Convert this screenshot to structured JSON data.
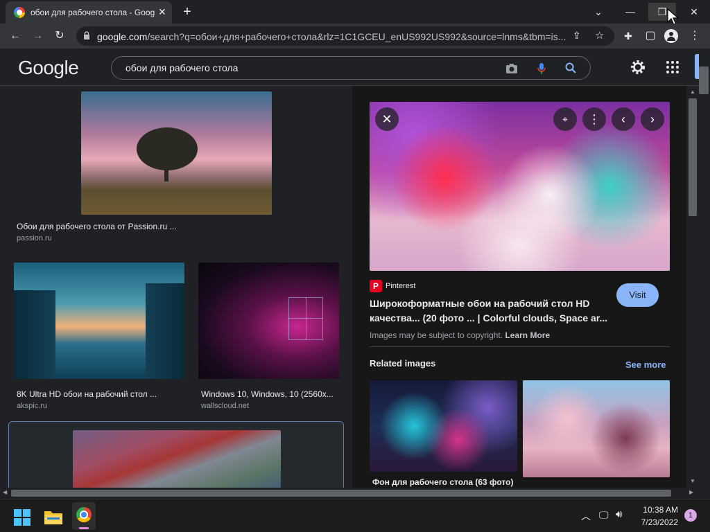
{
  "browser": {
    "tab_title": "обои для рабочего стола - Google Поиск",
    "url_host": "google.com",
    "url_rest": "/search?q=обои+для+рабочего+стола&rlz=1C1GCEU_enUS992US992&source=lnms&tbm=is..."
  },
  "google": {
    "logo": "Google",
    "query": "обои для рабочего стола"
  },
  "results": [
    {
      "caption": "Обои для рабочего стола от Passion.ru ...",
      "source": "passion.ru"
    },
    {
      "caption": "8K Ultra HD обои на рабочий стол ...",
      "source": "akspic.ru"
    },
    {
      "caption": "Windows 10, Windows, 10 (2560x...",
      "source": "wallscloud.net"
    }
  ],
  "preview": {
    "site": "Pinterest",
    "title_line1": "Широкоформатные обои на рабочий стол HD",
    "title_line2": "качества... (20 фото ... | Colorful clouds, Space ar...",
    "visit_label": "Visit",
    "copyright": "Images may be subject to copyright.",
    "learn_more": "Learn More",
    "related_label": "Related images",
    "see_more": "See more",
    "related_caption": "Фон для рабочего стола (63 фото)"
  },
  "taskbar": {
    "time": "10:38 AM",
    "date": "7/23/2022",
    "notification_count": "1"
  },
  "colors": {
    "accent_blue": "#8ab4f8",
    "visit_button": "#8ab4f8",
    "pinterest_red": "#e60023"
  }
}
